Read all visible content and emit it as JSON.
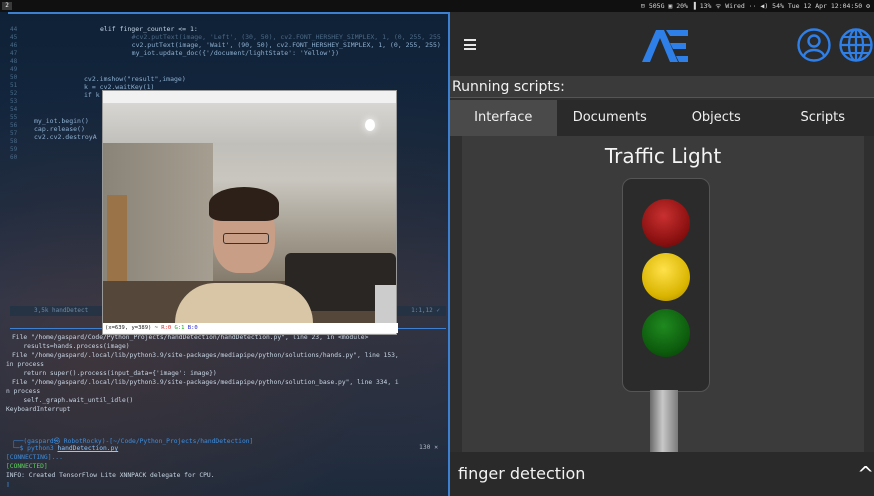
{
  "topbar": {
    "workspace": "2",
    "status": "⊟ 505G  ▣ 20%  ▐ 13%  ᯤ Wired  ··  ◀) 54%  Tue 12 Apr 12:04:50  ⚙"
  },
  "editor": {
    "line_numbers": [
      "44",
      "45",
      "46",
      "47",
      "48",
      "49",
      "50",
      "51",
      "52",
      "53",
      "54",
      "55",
      "56",
      "57",
      "58",
      "59",
      "60"
    ],
    "lines": [
      "elif finger_counter <= 1:",
      "    #cv2.putText(image, 'Left', (30, 50), cv2.FONT_HERSHEY_SIMPLEX, 1, (0, 255, 255",
      "    cv2.putText(image, 'Wait', (90, 50), cv2.FONT_HERSHEY_SIMPLEX, 1, (0, 255, 255)",
      "    my_iot.update_doc({'/document/lightState': 'Yellow'})",
      "cv2.imshow(\"result\",image)",
      "k = cv2.waitKey(1)",
      "if k",
      "my_iot.begin()",
      "cap.release()",
      "cv2.cv2.destroyA"
    ],
    "status_left": "3,5k   handDetect",
    "status_right": "1:1,12  ✓"
  },
  "image_window": {
    "status_pos": "(x=639, y=389) ~ ",
    "status_r": "R:0",
    "status_g": "G:1",
    "status_b": "B:0"
  },
  "terminal": {
    "lines": [
      "File \"/home/gaspard/Code/Python_Projects/handDetection/handDetection.py\", line 23, in <module>",
      "   results=hands.process(image)",
      "File \"/home/gaspard/.local/lib/python3.9/site-packages/mediapipe/python/solutions/hands.py\", line 153,",
      "in process",
      "   return super().process(input_data={'image': image})",
      "File \"/home/gaspard/.local/lib/python3.9/site-packages/mediapipe/python/solution_base.py\", line 334, i",
      "n process",
      "   self._graph.wait_until_idle()",
      "KeyboardInterrupt"
    ],
    "prompt_user": "┌──(gaspard㉿ RobotRocky)-[~/Code/Python_Projects/handDetection]",
    "prompt_cmd_prefix": "└─$ python3 ",
    "prompt_cmd_file": "handDetection.py",
    "connecting": "[CONNECTING]...",
    "connected": "[CONNECTED]",
    "info": "INFO: Created TensorFlow Lite XNNPACK delegate for CPU.",
    "cursor": "▯",
    "right_num": "130 ✕"
  },
  "app": {
    "running_label": "Running scripts:",
    "tabs": [
      "Interface",
      "Documents",
      "Objects",
      "Scripts"
    ],
    "active_tab": "Interface",
    "panel_title": "Traffic Light",
    "footer_label": "finger detection",
    "chevron": "^",
    "accent": "#2f7fe8"
  }
}
